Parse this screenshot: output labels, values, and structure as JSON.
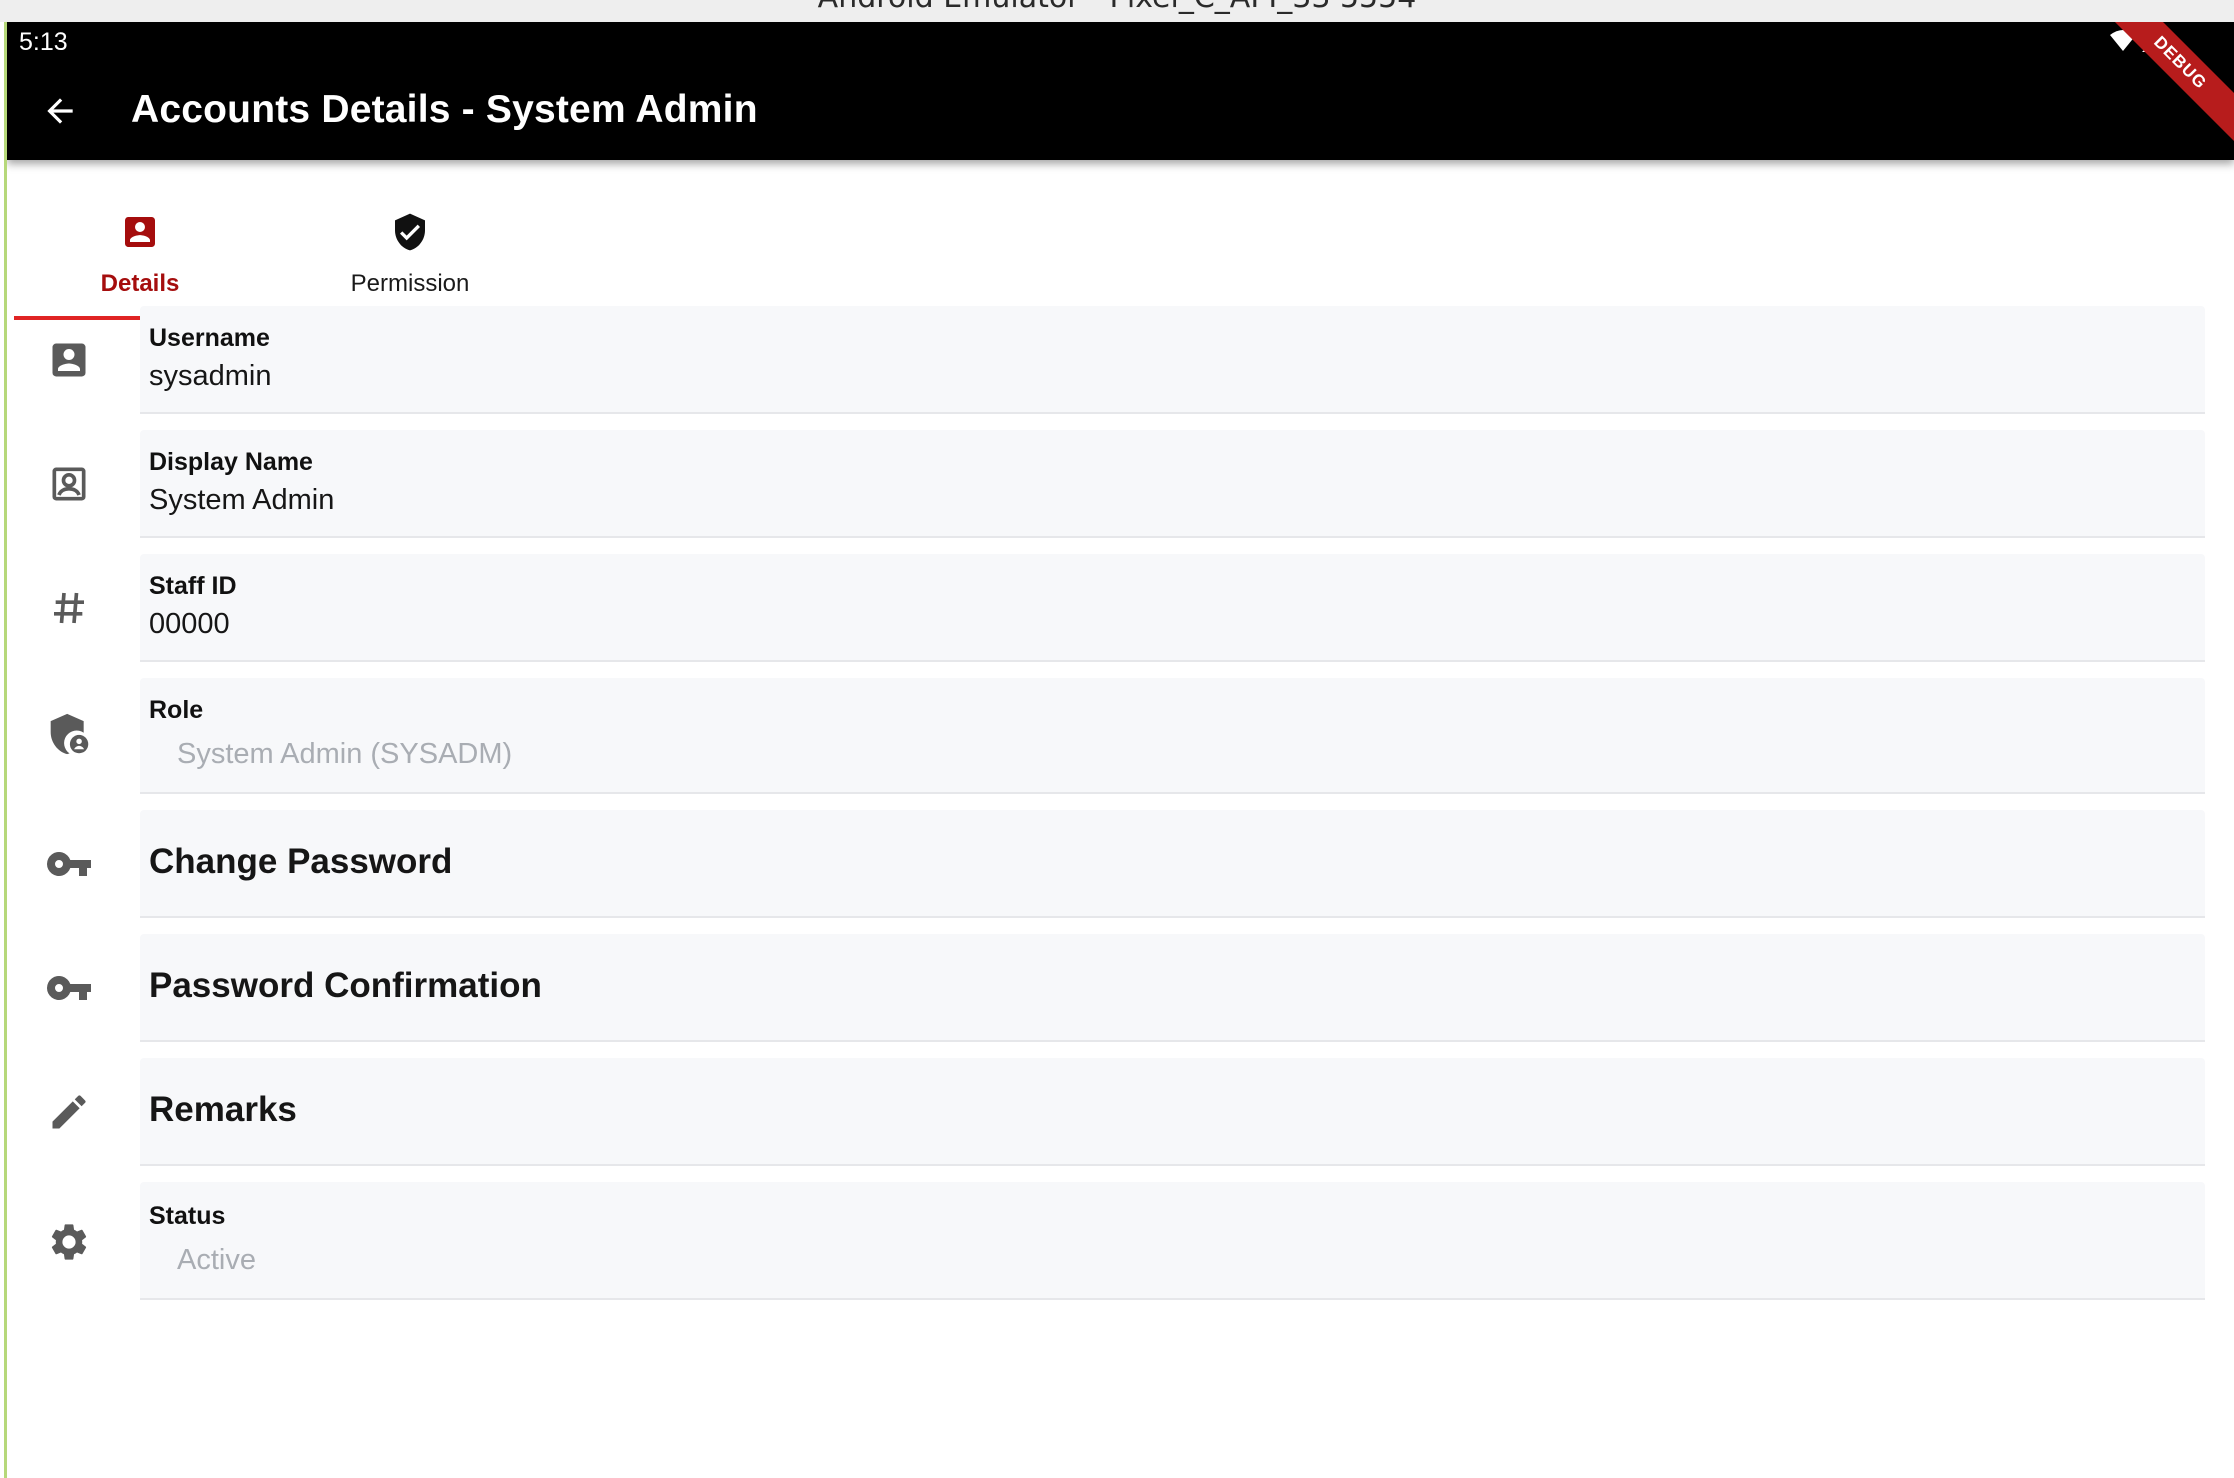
{
  "emulator": {
    "title": "Android Emulator - Pixel_C_API_33 5554"
  },
  "status_bar": {
    "time": "5:13"
  },
  "app_bar": {
    "title": "Accounts Details - System Admin",
    "debug_banner": "DEBUG"
  },
  "tabs": [
    {
      "label": "Details",
      "icon": "account-box-icon",
      "selected": true
    },
    {
      "label": "Permission",
      "icon": "verified-shield-icon",
      "selected": false
    }
  ],
  "fields": {
    "username": {
      "label": "Username",
      "value": "sysadmin",
      "icon": "account-box-icon"
    },
    "display_name": {
      "label": "Display Name",
      "value": "System Admin",
      "icon": "portrait-icon"
    },
    "staff_id": {
      "label": "Staff ID",
      "value": "00000",
      "icon": "hash-icon"
    },
    "role": {
      "label": "Role",
      "value": "System Admin (SYSADM)",
      "icon": "admin-shield-icon",
      "disabled": true
    },
    "change_password": {
      "placeholder": "Change Password",
      "icon": "key-icon"
    },
    "password_confirmation": {
      "placeholder": "Password Confirmation",
      "icon": "key-icon"
    },
    "remarks": {
      "placeholder": "Remarks",
      "icon": "pencil-icon"
    },
    "status": {
      "label": "Status",
      "value": "Active",
      "icon": "gear-icon",
      "disabled": true
    }
  },
  "colors": {
    "app_bar": "#000000",
    "accent": "#a50d0d",
    "tab_indicator": "#e02424",
    "field_background": "#f7f8fa",
    "icon": "#5a5a5a",
    "disabled_text": "#a9adb3"
  }
}
